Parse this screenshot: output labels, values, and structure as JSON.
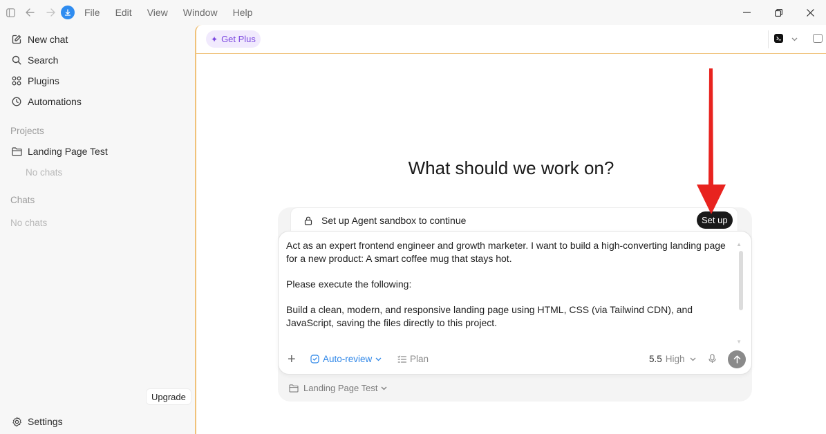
{
  "menu": [
    "File",
    "Edit",
    "View",
    "Window",
    "Help"
  ],
  "sidebar": {
    "items": [
      {
        "label": "New chat",
        "icon": "edit-icon"
      },
      {
        "label": "Search",
        "icon": "search-icon"
      },
      {
        "label": "Plugins",
        "icon": "grid-icon"
      },
      {
        "label": "Automations",
        "icon": "clock-icon"
      }
    ],
    "projects_label": "Projects",
    "project_name": "Landing Page Test",
    "project_empty": "No chats",
    "chats_label": "Chats",
    "chats_empty": "No chats",
    "settings_label": "Settings",
    "upgrade_label": "Upgrade"
  },
  "main": {
    "get_plus_label": "Get Plus",
    "heading": "What should we work on?",
    "notice_text": "Set up Agent sandbox to continue",
    "setup_label": "Set up",
    "prompt_lines": [
      "Act as an expert frontend engineer and growth marketer. I want to build a high-converting landing page for a new product: A smart coffee mug that stays hot.",
      "Please execute the following:",
      "Build a clean, modern, and responsive landing page using HTML, CSS (via Tailwind CDN), and JavaScript, saving the files directly to this project."
    ],
    "auto_review_label": "Auto-review",
    "plan_label": "Plan",
    "model_version": "5.5",
    "model_level": "High",
    "project_selector_label": "Landing Page Test"
  },
  "colors": {
    "accent_blue": "#2f87e8",
    "plus_purple": "#7b47e0",
    "annotation_red": "#e8231f",
    "panel_border": "#f0c27a"
  }
}
